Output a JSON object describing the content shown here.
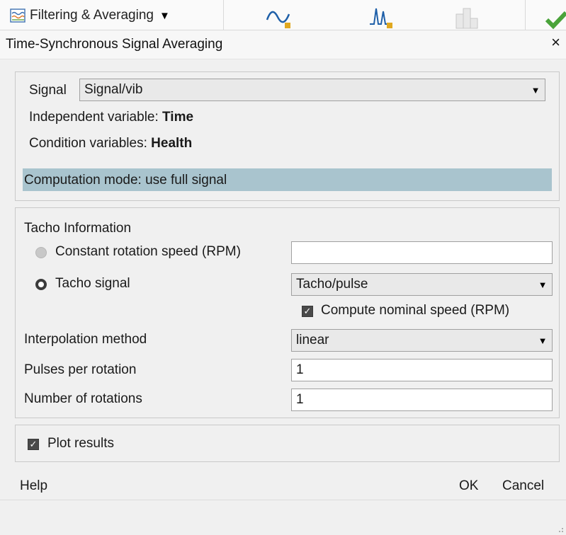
{
  "toolstrip": {
    "group_label": "Filtering & Averaging",
    "group_caret": "▼"
  },
  "dialog": {
    "title": "Time-Synchronous Signal Averaging",
    "close": "×"
  },
  "signal_panel": {
    "signal_label": "Signal",
    "signal_value": "Signal/vib",
    "independent_label": "Independent variable: ",
    "independent_value": "Time",
    "condition_label": "Condition variables: ",
    "condition_value": "Health",
    "computation_mode": "Computation mode: use full signal"
  },
  "tacho_panel": {
    "heading": "Tacho Information",
    "constant_speed_label": "Constant rotation speed (RPM)",
    "constant_speed_value": "",
    "tacho_signal_label": "Tacho signal",
    "tacho_signal_value": "Tacho/pulse",
    "compute_nominal_label": "Compute nominal speed (RPM)",
    "interpolation_label": "Interpolation method",
    "interpolation_value": "linear",
    "pulses_label": "Pulses per rotation",
    "pulses_value": "1",
    "rotations_label": "Number of rotations",
    "rotations_value": "1"
  },
  "plot_panel": {
    "plot_results_label": "Plot results"
  },
  "buttons": {
    "help": "Help",
    "ok": "OK",
    "cancel": "Cancel"
  },
  "colors": {
    "mode_bar": "#a9c4ce",
    "check_fill": "#4a4a4a"
  }
}
